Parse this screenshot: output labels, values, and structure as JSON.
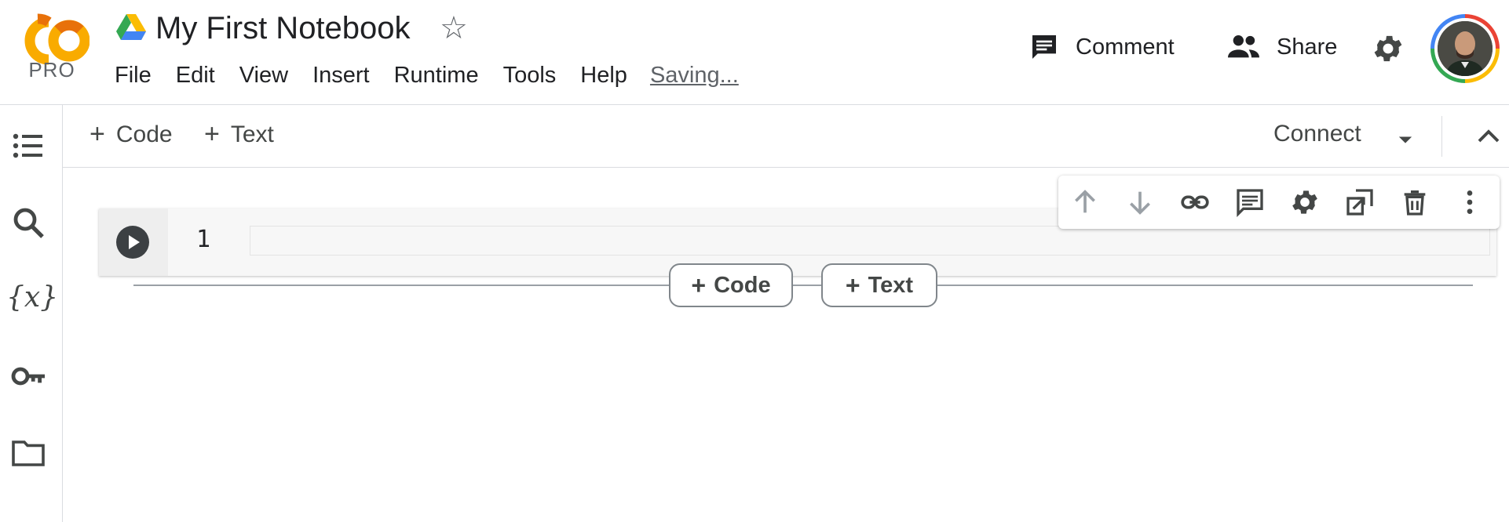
{
  "header": {
    "logo_text": "CO",
    "pro_label": "PRO",
    "title": "My First Notebook",
    "menu": [
      "File",
      "Edit",
      "View",
      "Insert",
      "Runtime",
      "Tools",
      "Help"
    ],
    "saving_status": "Saving...",
    "comment_label": "Comment",
    "share_label": "Share"
  },
  "sidebar": {
    "icons": [
      "table-of-contents-icon",
      "search-icon",
      "variables-icon",
      "key-icon",
      "folder-icon"
    ],
    "variables_glyph": "{x}"
  },
  "toolbar": {
    "add_code_label": "Code",
    "add_text_label": "Text",
    "connect_label": "Connect"
  },
  "cell": {
    "line_number": "1",
    "code": "",
    "toolbar_icons": [
      "arrow-up-icon",
      "arrow-down-icon",
      "link-icon",
      "comment-icon",
      "gear-icon",
      "mirror-cell-icon",
      "trash-icon",
      "more-vert-icon"
    ]
  },
  "add_cell": {
    "code_label": "Code",
    "text_label": "Text"
  },
  "colors": {
    "logo_orange": "#f9ab00",
    "logo_dark_orange": "#e8710a",
    "icon_grey": "#444746",
    "divider": "#dadce0"
  }
}
